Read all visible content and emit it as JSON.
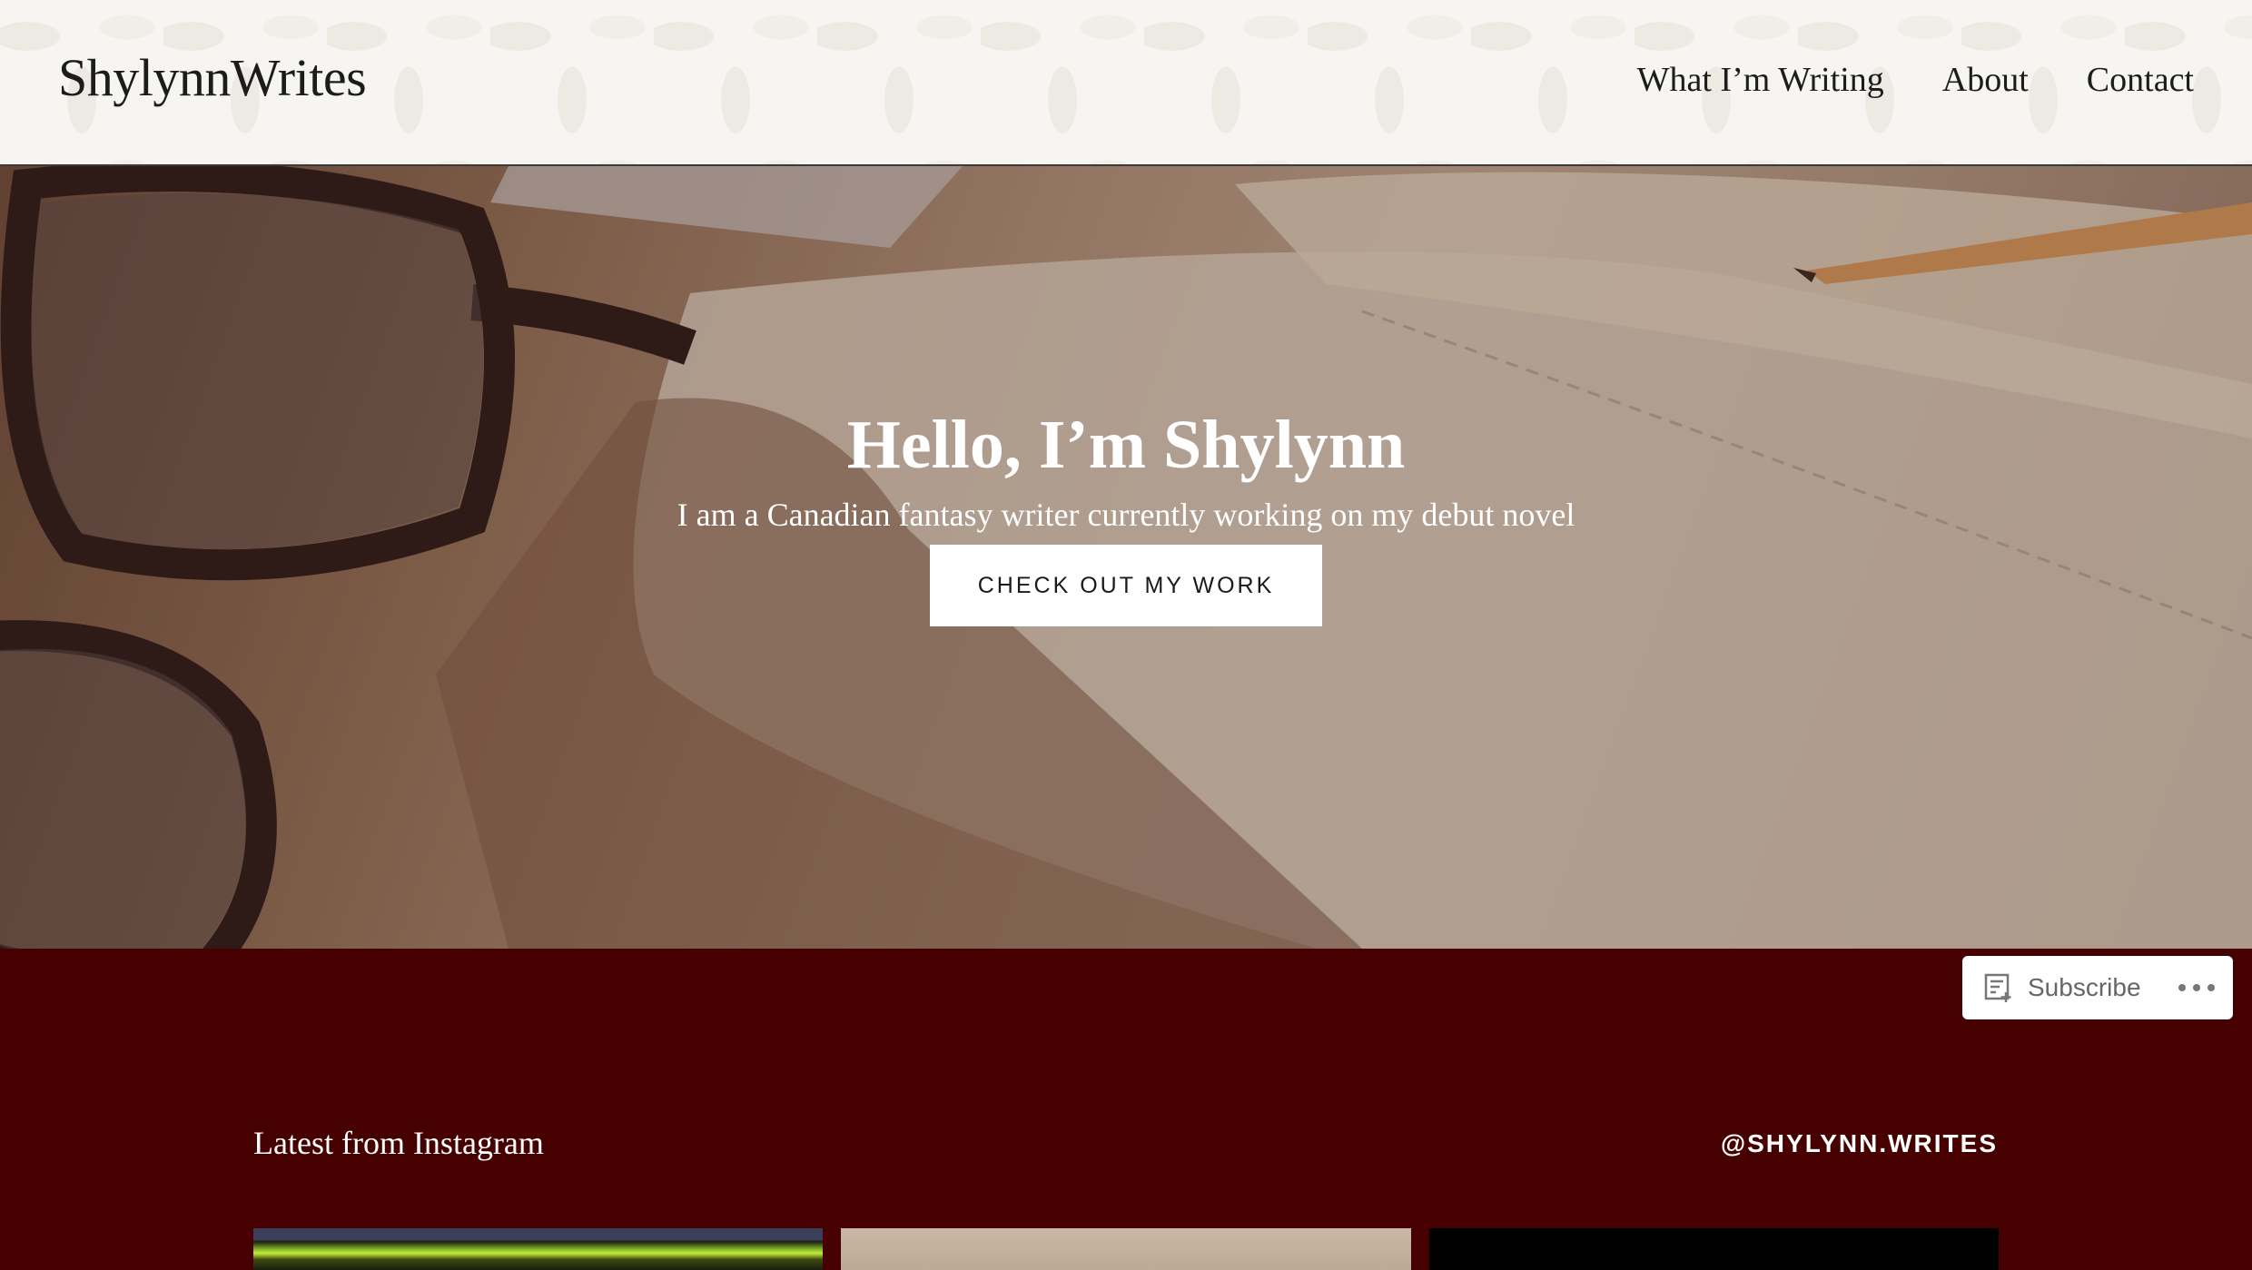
{
  "header": {
    "site_title": "ShylynnWrites",
    "nav": [
      "What I’m Writing",
      "About",
      "Contact"
    ]
  },
  "hero": {
    "title": "Hello, I’m Shylynn",
    "subtitle": "I am a Canadian fantasy writer currently working on my debut novel",
    "cta_label": "CHECK OUT MY WORK"
  },
  "subscribe_widget": {
    "label": "Subscribe",
    "icon": "reader-subscribe-icon",
    "more_icon": "ellipsis-icon"
  },
  "instagram": {
    "heading": "Latest from Instagram",
    "handle": "@SHYLYNN.WRITES",
    "thumbnails": 3
  },
  "colors": {
    "section_bg": "#470000",
    "header_bg": "#f6f5f1",
    "text_dark": "#1c1c1c",
    "text_light": "#ffffff"
  }
}
